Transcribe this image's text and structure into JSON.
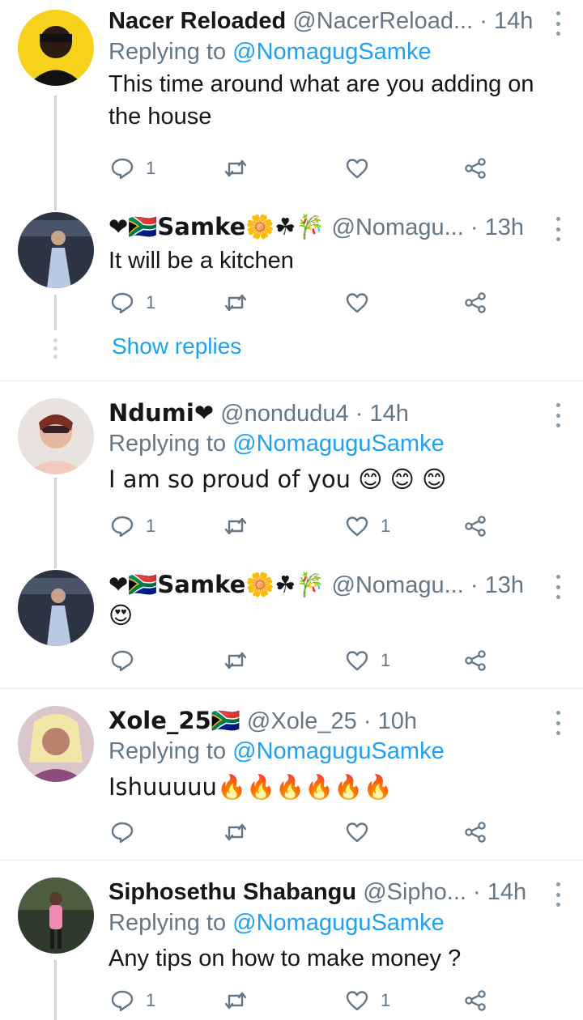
{
  "tweets": [
    {
      "name": "Nacer Reloaded",
      "handle": "@NacerReload...",
      "time": "14h",
      "replying_prefix": "Replying to ",
      "replying_to": "@NomagugSamke",
      "text": "This time around what are you adding on the house",
      "replies": "1",
      "retweets": "",
      "likes": ""
    },
    {
      "name": "❤🇿🇦Samke🌼☘🎋",
      "handle": "@Nomagu...",
      "time": "13h",
      "replying_prefix": "",
      "replying_to": "",
      "text": "It will be a kitchen",
      "replies": "1",
      "retweets": "",
      "likes": ""
    },
    {
      "name": "Ndumi❤",
      "handle": "@nondudu4",
      "time": "14h",
      "replying_prefix": "Replying to ",
      "replying_to": "@NomaguguSamke",
      "text": "I am so proud of you 😊 😊 😊",
      "replies": "1",
      "retweets": "",
      "likes": "1"
    },
    {
      "name": "❤🇿🇦Samke🌼☘🎋",
      "handle": "@Nomagu...",
      "time": "13h",
      "replying_prefix": "",
      "replying_to": "",
      "text": "😍",
      "replies": "",
      "retweets": "",
      "likes": "1"
    },
    {
      "name": "Xole_25🇿🇦",
      "handle": "@Xole_25",
      "time": "10h",
      "replying_prefix": "Replying to ",
      "replying_to": "@NomaguguSamke",
      "text": "Ishuuuuu🔥🔥🔥🔥🔥🔥",
      "replies": "",
      "retweets": "",
      "likes": ""
    },
    {
      "name": "Siphosethu Shabangu",
      "handle": "@Sipho...",
      "time": "14h",
      "replying_prefix": "Replying to ",
      "replying_to": "@NomaguguSamke",
      "text": "Any tips on how to make money ?",
      "replies": "1",
      "retweets": "",
      "likes": "1"
    }
  ],
  "show_replies": "Show replies",
  "separator": "·",
  "icons": {
    "reply": "reply-icon",
    "retweet": "retweet-icon",
    "like": "heart-icon",
    "share": "share-icon",
    "more": "more-icon"
  },
  "colors": {
    "accent": "#1da1f2",
    "muted": "#657786",
    "text": "#14171a",
    "heart": "#e0245e"
  }
}
